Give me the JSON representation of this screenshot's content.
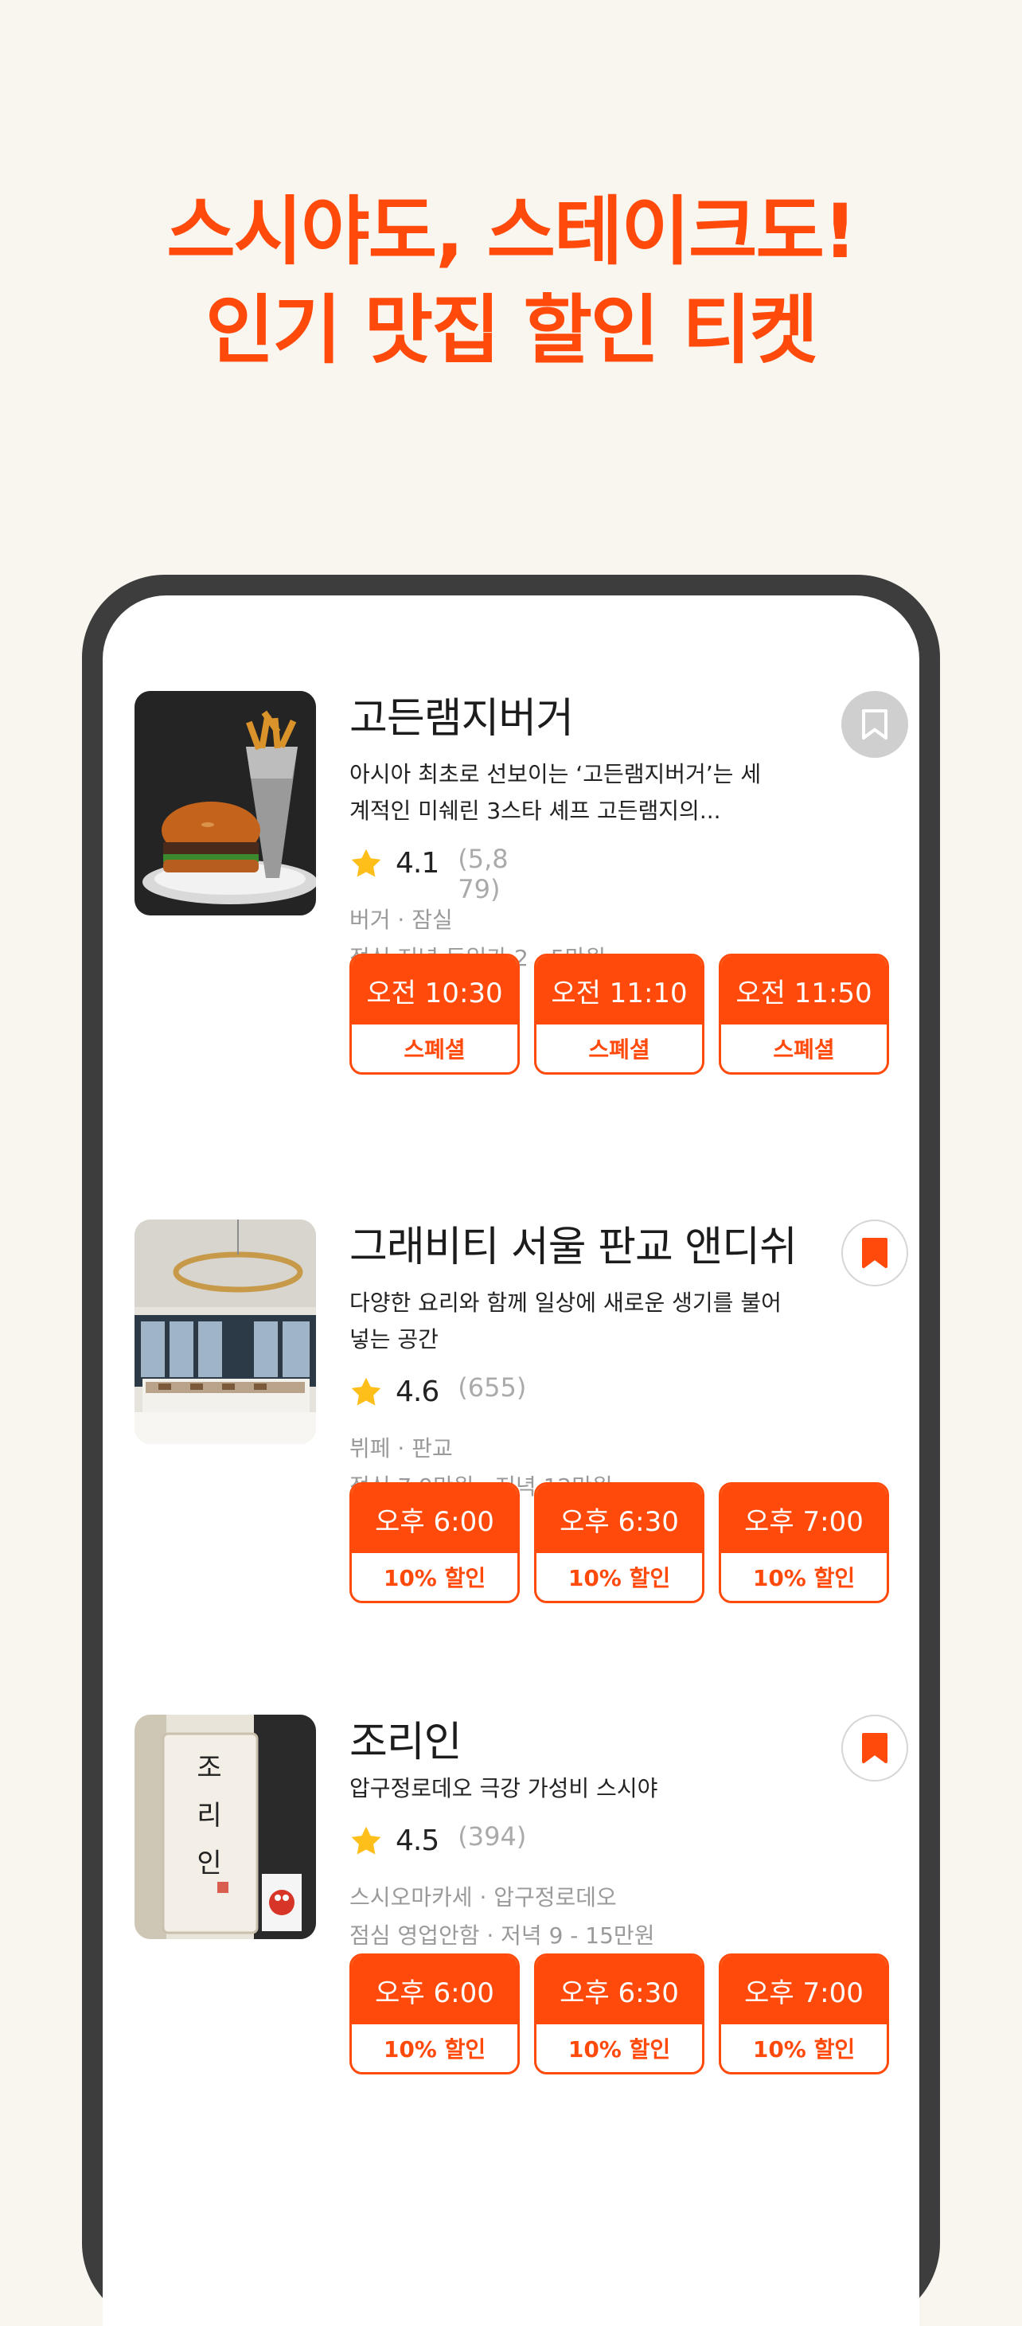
{
  "headline": {
    "line1": "스시야도, 스테이크도!",
    "line2": "인기 맛집 할인 티켓"
  },
  "colors": {
    "accent": "#ff4a0c",
    "star": "#ffbf1a",
    "background": "#f8f6ee"
  },
  "restaurants": [
    {
      "name": "고든램지버거",
      "description": "아시아 최초로 선보이는 ‘고든램지버거’는 세계적인 미쉐린 3스타 셰프 고든램지의...",
      "rating": "4.1",
      "reviews": "(5,879)",
      "category": "버거 · 잠실",
      "price": "점심 저녁 동일가 2 - 5만원",
      "bookmarked": false,
      "bookmark_icon": "bookmark-outline-icon",
      "image_icon": "burger-photo",
      "slots": [
        {
          "time": "오전 10:30",
          "tag": "스폐셜"
        },
        {
          "time": "오전 11:10",
          "tag": "스폐셜"
        },
        {
          "time": "오전 11:50",
          "tag": "스폐셜"
        }
      ]
    },
    {
      "name": "그래비티 서울 판교 앤디쉬",
      "description": "다양한 요리와 함께 일상에 새로운 생기를 불어넣는 공간",
      "rating": "4.6",
      "reviews": "(655)",
      "category": "뷔페 · 판교",
      "price": "점심 7.9만원 · 저녁 12만원",
      "bookmarked": true,
      "bookmark_icon": "bookmark-filled-icon",
      "image_icon": "buffet-photo",
      "slots": [
        {
          "time": "오후 6:00",
          "tag": "10% 할인"
        },
        {
          "time": "오후 6:30",
          "tag": "10% 할인"
        },
        {
          "time": "오후 7:00",
          "tag": "10% 할인"
        }
      ]
    },
    {
      "name": "조리인",
      "description": "압구정로데오 극강 가성비 스시야",
      "rating": "4.5",
      "reviews": "(394)",
      "category": "스시오마카세 · 압구정로데오",
      "price": "점심 영업안함 · 저녁 9 - 15만원",
      "bookmarked": true,
      "bookmark_icon": "bookmark-filled-icon",
      "image_icon": "sushi-sign-photo",
      "sign_text": [
        "조",
        "리",
        "인"
      ],
      "slots": [
        {
          "time": "오후 6:00",
          "tag": "10% 할인"
        },
        {
          "time": "오후 6:30",
          "tag": "10% 할인"
        },
        {
          "time": "오후 7:00",
          "tag": "10% 할인"
        }
      ]
    }
  ]
}
